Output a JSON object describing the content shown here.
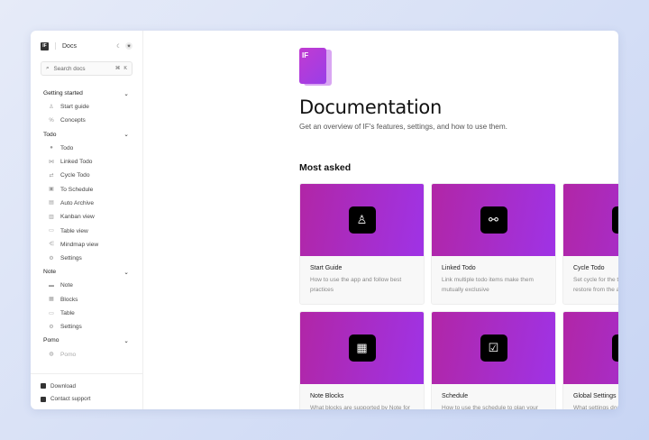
{
  "app": {
    "logo": "IF",
    "title": "Docs"
  },
  "search": {
    "placeholder": "Search docs",
    "shortcut": [
      "⌘",
      "K"
    ]
  },
  "sidebar": {
    "groups": [
      {
        "label": "Getting started",
        "items": [
          {
            "label": "Start guide",
            "icon": "scholar-icon"
          },
          {
            "label": "Concepts",
            "icon": "concepts-icon"
          }
        ]
      },
      {
        "label": "Todo",
        "items": [
          {
            "label": "Todo",
            "icon": "todo-icon"
          },
          {
            "label": "Linked Todo",
            "icon": "link-icon"
          },
          {
            "label": "Cycle Todo",
            "icon": "repeat-icon"
          },
          {
            "label": "To Schedule",
            "icon": "calendar-icon"
          },
          {
            "label": "Auto Archive",
            "icon": "archive-icon"
          },
          {
            "label": "Kanban view",
            "icon": "kanban-icon"
          },
          {
            "label": "Table view",
            "icon": "table-icon"
          },
          {
            "label": "Mindmap view",
            "icon": "mindmap-icon"
          },
          {
            "label": "Settings",
            "icon": "gear-icon"
          }
        ]
      },
      {
        "label": "Note",
        "items": [
          {
            "label": "Note",
            "icon": "note-icon"
          },
          {
            "label": "Blocks",
            "icon": "blocks-icon"
          },
          {
            "label": "Table",
            "icon": "table-icon"
          },
          {
            "label": "Settings",
            "icon": "gear-icon"
          }
        ]
      },
      {
        "label": "Pomo",
        "items": [
          {
            "label": "Pomo",
            "icon": "timer-icon"
          }
        ]
      }
    ],
    "footer": [
      {
        "label": "Download",
        "icon": "download-icon"
      },
      {
        "label": "Contact support",
        "icon": "chat-icon"
      }
    ]
  },
  "main": {
    "logo_text": "IF",
    "title": "Documentation",
    "subtitle": "Get an overview of IF's features, settings, and how to use them.",
    "section": "Most asked",
    "cards": [
      {
        "title": "Start Guide",
        "desc": "How to use the app and follow best practices",
        "icon": "scholar-icon"
      },
      {
        "title": "Linked Todo",
        "desc": "Link multiple todo items make them mutually exclusive",
        "icon": "link-nodes-icon"
      },
      {
        "title": "Cycle Todo",
        "desc": "Set cycle for the todo, it will auto restore from the archive",
        "icon": "repeat-icon"
      },
      {
        "title": "Note Blocks",
        "desc": "What blocks are supported by Note for",
        "icon": "blocks-icon"
      },
      {
        "title": "Schedule",
        "desc": "How to use the schedule to plan your",
        "icon": "calendar-check-icon"
      },
      {
        "title": "Global Settings",
        "desc": "What settings does IF support to adjust",
        "icon": "sliders-icon"
      }
    ]
  },
  "colors": {
    "card_gradient_start": "#b126a6",
    "card_gradient_end": "#9f33e6"
  }
}
